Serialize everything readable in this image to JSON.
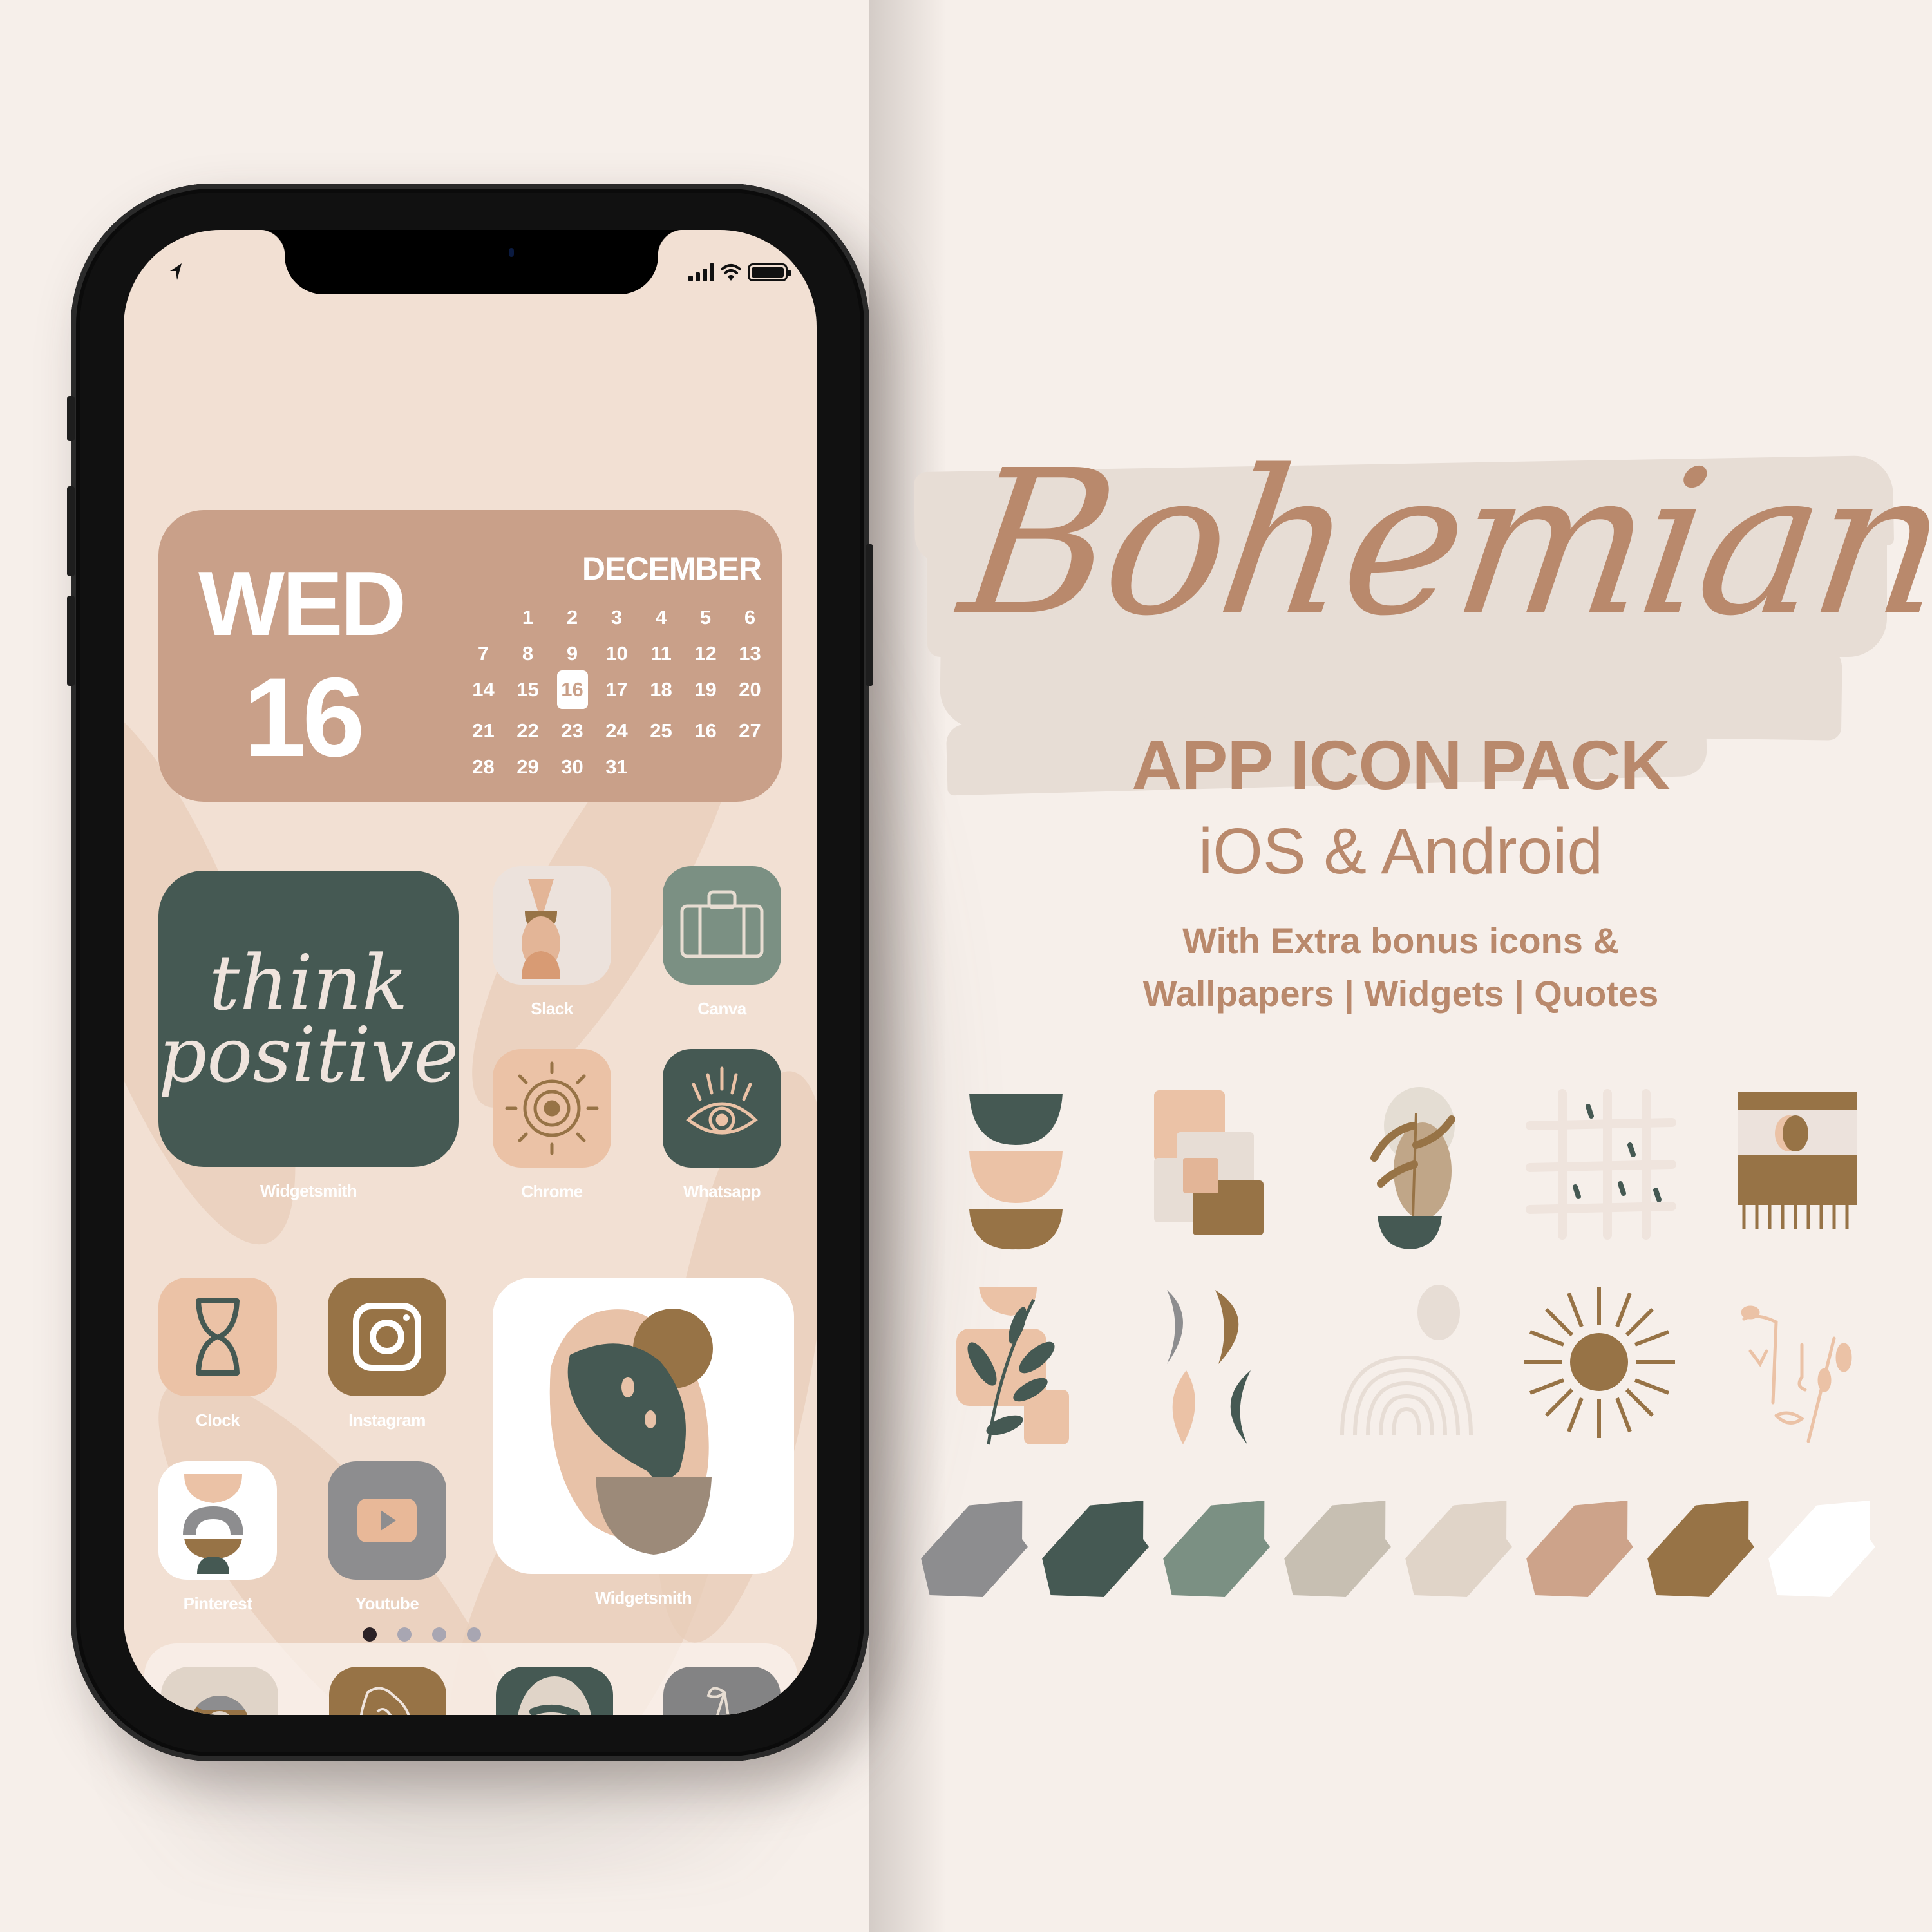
{
  "status_bar": {
    "location_icon": "location-arrow-icon",
    "signal_icon": "cellular-signal-icon",
    "wifi_icon": "wifi-icon",
    "battery_icon": "battery-icon"
  },
  "calendar_widget": {
    "day_of_week": "WED",
    "day_number": "16",
    "month": "DECEMBER",
    "highlighted_day": "16",
    "weeks": [
      [
        "",
        "1",
        "2",
        "3",
        "4",
        "5",
        "6"
      ],
      [
        "7",
        "8",
        "9",
        "10",
        "11",
        "12",
        "13"
      ],
      [
        "14",
        "15",
        "16",
        "17",
        "18",
        "19",
        "20"
      ],
      [
        "21",
        "22",
        "23",
        "24",
        "25",
        "16",
        "27"
      ],
      [
        "28",
        "29",
        "30",
        "31",
        "",
        "",
        ""
      ]
    ]
  },
  "home_screen": {
    "quote_widget": {
      "line1": "think",
      "line2": "positive",
      "label": "Widgetsmith"
    },
    "apps": [
      {
        "name": "Slack",
        "icon": "abstract-vase-icon",
        "bg": "#ece2dc"
      },
      {
        "name": "Canva",
        "icon": "suitcase-icon",
        "bg": "#7b9083"
      },
      {
        "name": "Chrome",
        "icon": "sun-spiral-icon",
        "bg": "#ebc2a6"
      },
      {
        "name": "Whatsapp",
        "icon": "eye-icon",
        "bg": "#455953"
      },
      {
        "name": "Clock",
        "icon": "hourglass-icon",
        "bg": "#ebc2a6"
      },
      {
        "name": "Instagram",
        "icon": "instagram-camera-icon",
        "bg": "#977346"
      },
      {
        "name": "Pinterest",
        "icon": "stacked-shapes-icon",
        "bg": "#ffffff"
      },
      {
        "name": "Youtube",
        "icon": "play-button-icon",
        "bg": "#8d8d8f"
      }
    ],
    "plant_widget": {
      "label": "Widgetsmith",
      "icon": "monstera-plant-icon"
    },
    "page_dots": {
      "count": 4,
      "active": 1
    },
    "dock": [
      {
        "icon": "chrome-logo-icon",
        "bg": "#e0d4c8"
      },
      {
        "icon": "face-line-art-icon",
        "bg": "#977346"
      },
      {
        "icon": "spotify-logo-icon",
        "bg": "#455953"
      },
      {
        "icon": "cherry-icon",
        "bg": "#838384"
      }
    ]
  },
  "promo": {
    "title": "Bohemian",
    "subtitle": "APP ICON PACK",
    "platforms": "iOS & Android",
    "bonus_line1": "With Extra bonus icons &",
    "bonus_line2": "Wallpapers | Widgets | Quotes"
  },
  "showcase_icons": [
    {
      "icon": "stacked-half-circles-icon",
      "bg": "#ece2dc"
    },
    {
      "icon": "overlapping-squares-icon",
      "bg": "#455953"
    },
    {
      "icon": "potted-fern-icon",
      "bg": "#ffffff"
    },
    {
      "icon": "woven-grid-icon",
      "bg": "#977346"
    },
    {
      "icon": "tapestry-icon",
      "bg": "#ebc2a6"
    },
    {
      "icon": "leaf-branch-icon",
      "bg": "#977346"
    },
    {
      "icon": "crescent-shapes-icon",
      "bg": "#a9b8b0"
    },
    {
      "icon": "rainbow-moon-icon",
      "bg": "#838384"
    },
    {
      "icon": "sunburst-icon",
      "bg": "#ece2dc"
    },
    {
      "icon": "face-leaf-line-art-icon",
      "bg": "#455953"
    }
  ],
  "palette": [
    "#8d8d8f",
    "#455953",
    "#7b9083",
    "#c7bfb2",
    "#e0d4c8",
    "#cda38a",
    "#977346",
    "#ffffff"
  ],
  "colors": {
    "accent": "#b9896c",
    "calendar_bg": "#c9a089",
    "dark_green": "#455953",
    "brown": "#977346",
    "peach": "#ebc2a6",
    "background": "#f6efea"
  }
}
